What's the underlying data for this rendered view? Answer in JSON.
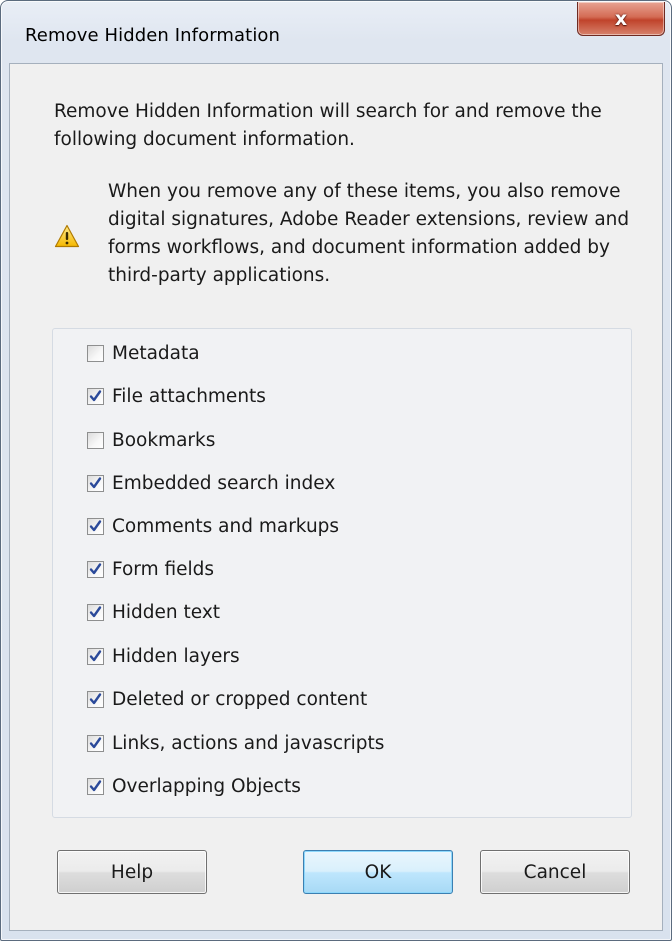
{
  "window": {
    "title": "Remove Hidden Information",
    "close_label": "x"
  },
  "dialog": {
    "intro": "Remove Hidden Information will search for and remove the following document information.",
    "warning": "When you remove any of these items, you also remove digital signatures, Adobe Reader extensions, review and forms workflows, and document information added by third-party applications.",
    "warning_icon": "warning-triangle-icon"
  },
  "options": [
    {
      "label": "Metadata",
      "checked": false
    },
    {
      "label": "File attachments",
      "checked": true
    },
    {
      "label": "Bookmarks",
      "checked": false
    },
    {
      "label": "Embedded search index",
      "checked": true
    },
    {
      "label": "Comments and markups",
      "checked": true
    },
    {
      "label": "Form fields",
      "checked": true
    },
    {
      "label": "Hidden text",
      "checked": true
    },
    {
      "label": "Hidden layers",
      "checked": true
    },
    {
      "label": "Deleted or cropped content",
      "checked": true
    },
    {
      "label": "Links, actions and javascripts",
      "checked": true
    },
    {
      "label": "Overlapping Objects",
      "checked": true
    }
  ],
  "buttons": {
    "help": "Help",
    "ok": "OK",
    "cancel": "Cancel"
  },
  "colors": {
    "check_mark": "#2b4a9a",
    "close_button": "#c7452d",
    "default_button_border": "#3c7fb1"
  }
}
